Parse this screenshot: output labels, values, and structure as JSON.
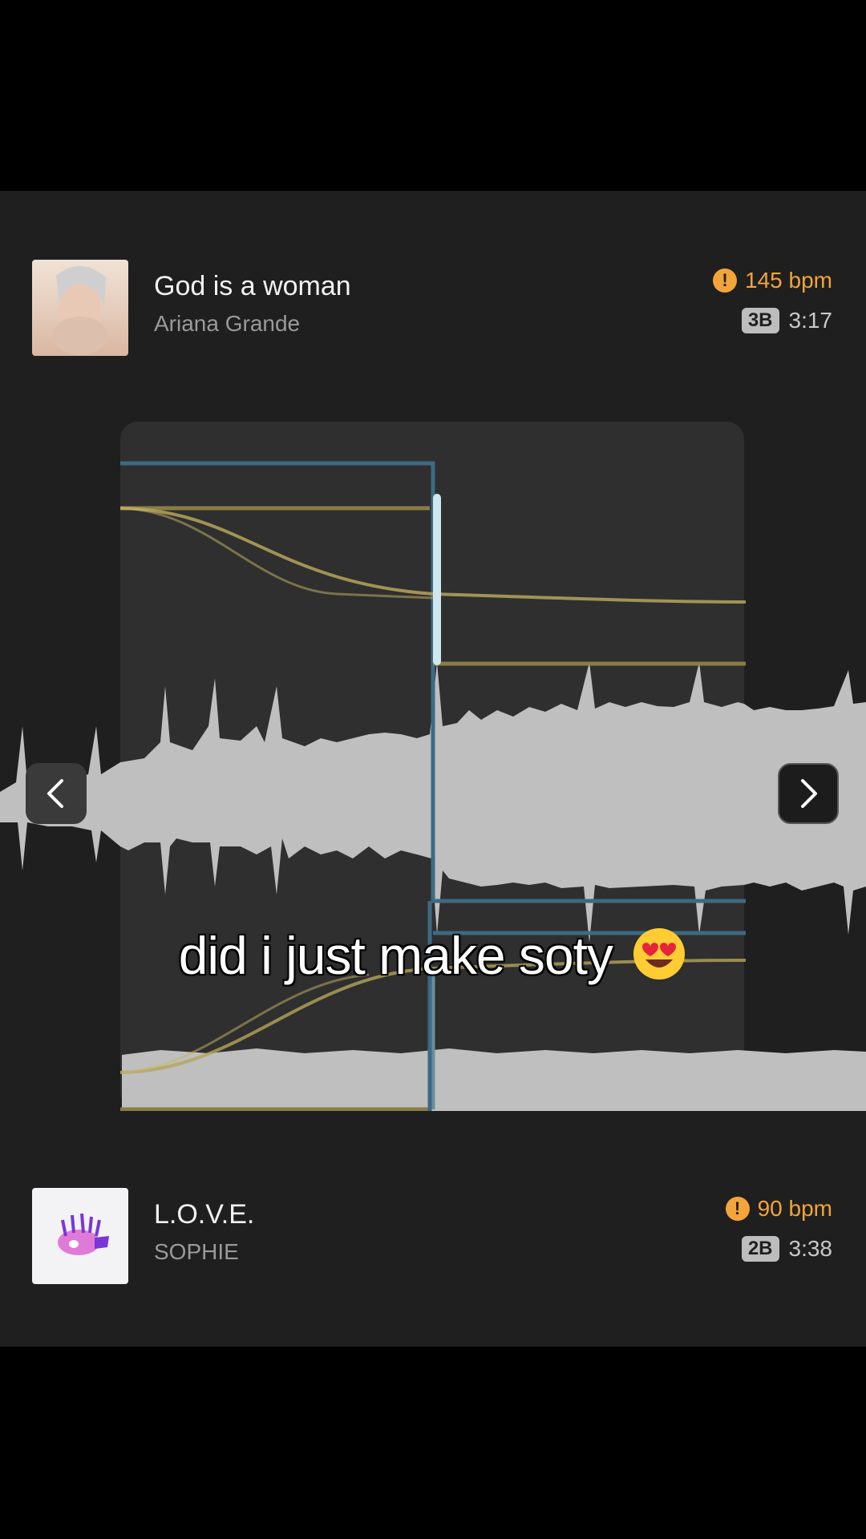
{
  "tracks": [
    {
      "title": "God is a woman",
      "artist": "Ariana Grande",
      "bpm": "145 bpm",
      "key": "3B",
      "duration": "3:17",
      "warning_icon": "warning-icon"
    },
    {
      "title": "L.O.V.E.",
      "artist": "SOPHIE",
      "bpm": "90 bpm",
      "key": "2B",
      "duration": "3:38",
      "warning_icon": "warning-icon"
    }
  ],
  "nav": {
    "prev_icon": "chevron-left-icon",
    "next_icon": "chevron-right-icon"
  },
  "caption": {
    "text": "did i just make soty",
    "emoji": "heart-eyes-emoji"
  },
  "colors": {
    "background": "#1f1f1f",
    "accent_orange": "#f3a43a",
    "waveform": "#bfbfbf",
    "blue_line": "#3d6a84",
    "yellow_line": "#b5a55a"
  }
}
